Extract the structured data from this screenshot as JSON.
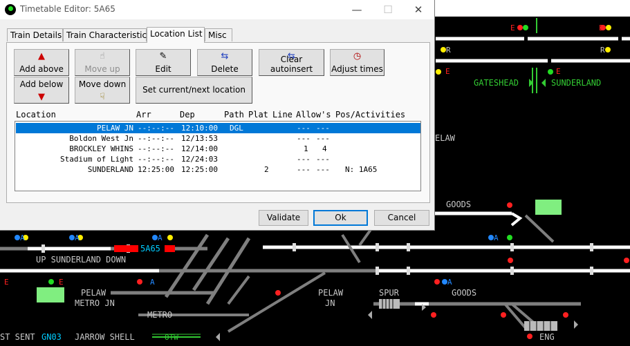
{
  "window": {
    "title": "Timetable Editor: 5A65",
    "minimize_glyph": "—",
    "maximize_glyph": "☐",
    "close_glyph": "✕"
  },
  "tabs": [
    {
      "label": "Train Details",
      "active": false
    },
    {
      "label": "Train Characteristics",
      "active": false
    },
    {
      "label": "Location List",
      "active": true
    },
    {
      "label": "Misc",
      "active": false
    }
  ],
  "buttons": {
    "add_above": "Add above",
    "add_below": "Add below",
    "move_up": "Move up",
    "move_down": "Move down",
    "edit": "Edit",
    "delete": "Delete",
    "clear_autoinsert": "Clear autoinsert",
    "adjust_times": "Adjust times",
    "set_current_next": "Set current/next location"
  },
  "location_table": {
    "columns": [
      "Location",
      "Arr",
      "Dep",
      "Path",
      "Plat",
      "Line",
      "Allow's",
      "Pos/Activities"
    ],
    "rows": [
      {
        "location": "PELAW JN",
        "arr": "--:--:--",
        "dep": "12:10:00",
        "path": "DGL",
        "plat": "",
        "line": "",
        "allow1": "---",
        "allow2": "---",
        "pos": "",
        "selected": true
      },
      {
        "location": "Boldon West Jn",
        "arr": "--:--:--",
        "dep": "12/13:53",
        "path": "",
        "plat": "",
        "line": "",
        "allow1": "---",
        "allow2": "---",
        "pos": "",
        "selected": false
      },
      {
        "location": "BROCKLEY WHINS",
        "arr": "--:--:--",
        "dep": "12/14:00",
        "path": "",
        "plat": "",
        "line": "",
        "allow1": "1",
        "allow2": "4",
        "pos": "",
        "selected": false
      },
      {
        "location": "Stadium of Light",
        "arr": "--:--:--",
        "dep": "12/24:03",
        "path": "",
        "plat": "",
        "line": "",
        "allow1": "---",
        "allow2": "---",
        "pos": "",
        "selected": false
      },
      {
        "location": "SUNDERLAND",
        "arr": "12:25:00",
        "dep": "12:25:00",
        "path": "",
        "plat": "2",
        "line": "",
        "allow1": "---",
        "allow2": "---",
        "pos": "N: 1A65",
        "selected": false
      }
    ]
  },
  "dialog_buttons": {
    "validate": "Validate",
    "ok": "Ok",
    "cancel": "Cancel"
  },
  "signal_panel": {
    "labels": {
      "gateshead": "GATESHEAD",
      "sunderland": "SUNDERLAND",
      "elaw": "ELAW",
      "goods_top": "GOODS",
      "up_sunderland_down": "UP SUNDERLAND DOWN",
      "pelaw_metro_jn_1": "PELAW",
      "pelaw_metro_jn_2": "METRO JN",
      "metro": "METRO",
      "pelaw_jn_1": "PELAW",
      "pelaw_jn_2": "JN",
      "spur": "SPUR",
      "goods_bottom": "GOODS",
      "eng": "ENG",
      "jarrow_shell": "JARROW SHELL",
      "st_sent": "ST SENT",
      "gn03": "GN03",
      "otw": "OTW",
      "train_5a65": "5A65",
      "signal_r1": "R",
      "signal_r2": "R",
      "signal_e1": "E",
      "signal_e2": "E",
      "signal_e3": "E",
      "signal_e4": "E",
      "signal_e5": "E",
      "signal_e6": "E",
      "signal_a1": "A",
      "signal_a2": "A",
      "signal_a3": "A",
      "signal_a4": "A",
      "signal_a5": "A",
      "signal_a6": "A"
    },
    "colors": {
      "track": "#7f7f7f",
      "route": "#ffffff",
      "label_green": "#33cc33",
      "label_white": "#c8c8c8",
      "signal_red": "#ff2020",
      "signal_yellow": "#ffee00",
      "signal_green": "#22dd22",
      "signal_blue": "#2288ff",
      "train_red": "#ff0000",
      "train_cyan": "#00ccff",
      "platform_green": "#80ee80"
    }
  }
}
